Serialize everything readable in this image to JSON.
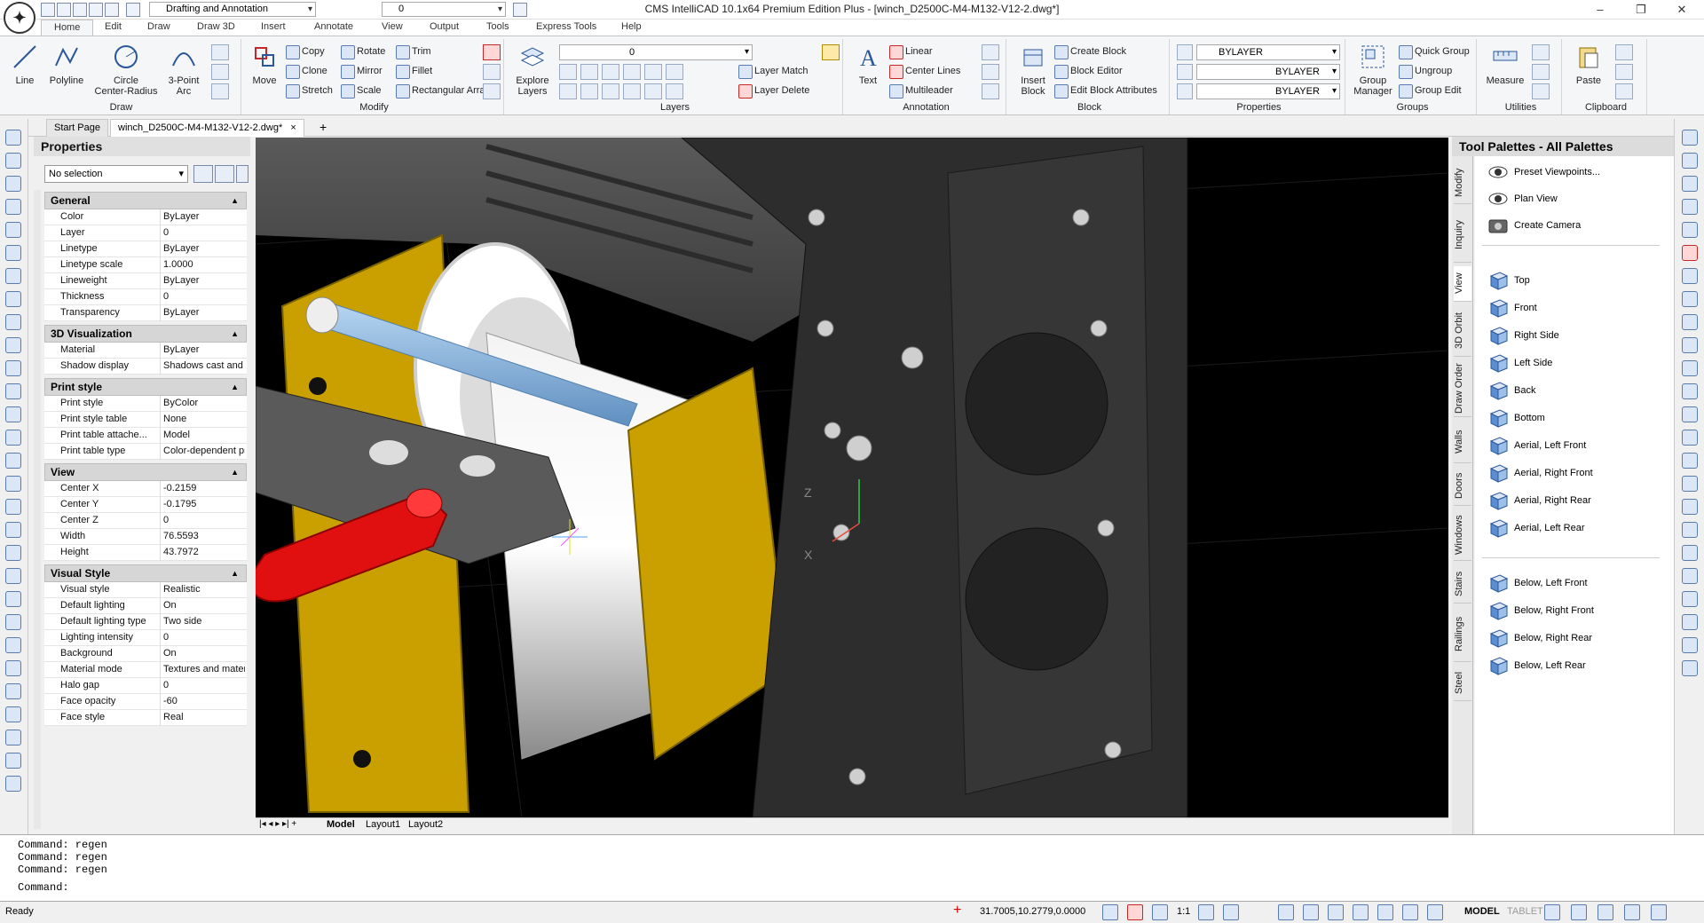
{
  "titlebar": {
    "workspace": "Drafting and Annotation",
    "layer_value": "0",
    "title": "CMS IntelliCAD 10.1x64 Premium Edition Plus - [winch_D2500C-M4-M132-V12-2.dwg*]"
  },
  "ribbon_tabs": [
    "Home",
    "Edit",
    "Draw",
    "Draw 3D",
    "Insert",
    "Annotate",
    "View",
    "Output",
    "Tools",
    "Express Tools",
    "Help"
  ],
  "draw": {
    "title": "Draw",
    "line": "Line",
    "polyline": "Polyline",
    "circle": "Circle",
    "circle_sub": "Center-Radius",
    "arc": "3-Point",
    "arc_sub": "Arc"
  },
  "modify": {
    "title": "Modify",
    "move": "Move",
    "copy": "Copy",
    "rotate": "Rotate",
    "trim": "Trim",
    "clone": "Clone",
    "mirror": "Mirror",
    "fillet": "Fillet",
    "stretch": "Stretch",
    "scale": "Scale",
    "rect_array": "Rectangular Array"
  },
  "layers": {
    "title": "Layers",
    "explore": "Explore",
    "explore_sub": "Layers",
    "current": "0",
    "layer_match": "Layer Match",
    "layer_delete": "Layer Delete"
  },
  "annotation": {
    "title": "Annotation",
    "text": "Text",
    "linear": "Linear",
    "center_lines": "Center Lines",
    "multileader": "Multileader"
  },
  "block": {
    "title": "Block",
    "insert": "Insert",
    "insert_sub": "Block",
    "create": "Create Block",
    "editor": "Block Editor",
    "edit_attr": "Edit Block Attributes"
  },
  "properties_ribbon": {
    "title": "Properties",
    "color": "BYLAYER",
    "linetype": "BYLAYER",
    "lineweight": "BYLAYER"
  },
  "groups": {
    "title": "Groups",
    "manager": "Group",
    "manager_sub": "Manager",
    "quick_group": "Quick Group",
    "ungroup": "Ungroup",
    "group_edit": "Group Edit"
  },
  "utilities": {
    "title": "Utilities",
    "measure": "Measure"
  },
  "clipboard": {
    "title": "Clipboard",
    "paste": "Paste"
  },
  "doc_tabs": {
    "start": "Start Page",
    "file": "winch_D2500C-M4-M132-V12-2.dwg*",
    "close": "×",
    "add": "+"
  },
  "properties_panel": {
    "title": "Properties",
    "selection": "No selection",
    "sections": [
      {
        "name": "General",
        "rows": [
          [
            "Color",
            "ByLayer"
          ],
          [
            "Layer",
            "0"
          ],
          [
            "Linetype",
            "ByLayer"
          ],
          [
            "Linetype scale",
            "1.0000"
          ],
          [
            "Lineweight",
            "ByLayer"
          ],
          [
            "Thickness",
            "0"
          ],
          [
            "Transparency",
            "ByLayer"
          ]
        ]
      },
      {
        "name": "3D Visualization",
        "rows": [
          [
            "Material",
            "ByLayer"
          ],
          [
            "Shadow display",
            "Shadows cast and ..."
          ]
        ]
      },
      {
        "name": "Print style",
        "rows": [
          [
            "Print style",
            "ByColor"
          ],
          [
            "Print style table",
            "None"
          ],
          [
            "Print table attache...",
            "Model"
          ],
          [
            "Print table type",
            "Color-dependent pr..."
          ]
        ]
      },
      {
        "name": "View",
        "rows": [
          [
            "Center X",
            "-0.2159"
          ],
          [
            "Center Y",
            "-0.1795"
          ],
          [
            "Center Z",
            "0"
          ],
          [
            "Width",
            "76.5593"
          ],
          [
            "Height",
            "43.7972"
          ]
        ]
      },
      {
        "name": "Visual Style",
        "rows": [
          [
            "Visual style",
            "Realistic"
          ],
          [
            "Default lighting",
            "On"
          ],
          [
            "Default lighting type",
            "Two side"
          ],
          [
            "Lighting intensity",
            "0"
          ],
          [
            "Background",
            "On"
          ],
          [
            "Material mode",
            "Textures and mater..."
          ],
          [
            "Halo gap",
            "0"
          ],
          [
            "Face opacity",
            "-60"
          ],
          [
            "Face style",
            "Real"
          ]
        ]
      }
    ]
  },
  "layout_tabs": [
    "Model",
    "Layout1",
    "Layout2"
  ],
  "ucs": {
    "x": "X",
    "z": "Z"
  },
  "tool_palette": {
    "title": "Tool Palettes - All Palettes",
    "vtabs": [
      "Modify",
      "Inquiry",
      "View",
      "3D Orbit",
      "Draw Order",
      "Walls",
      "Doors",
      "Windows",
      "Stairs",
      "Railings",
      "Steel"
    ],
    "items": [
      "Preset Viewpoints...",
      "Plan View",
      "Create Camera",
      "Top",
      "Front",
      "Right Side",
      "Left Side",
      "Back",
      "Bottom",
      "Aerial, Left Front",
      "Aerial, Right Front",
      "Aerial, Right Rear",
      "Aerial, Left Rear",
      "Below, Left Front",
      "Below, Right Front",
      "Below, Right Rear",
      "Below, Left Rear"
    ]
  },
  "command": {
    "history": [
      "Command: regen",
      "Command: regen",
      "Command: regen"
    ],
    "prompt": "Command:"
  },
  "status": {
    "ready": "Ready",
    "coords": "31.7005,10.2779,0.0000",
    "scale": "1:1",
    "model": "MODEL",
    "tablet": "TABLET"
  },
  "colors": {
    "accent": "#2b579a",
    "frame_yellow": "#c9a000",
    "red_handle": "#e01010",
    "shaft_blue": "#8ab8e6"
  }
}
